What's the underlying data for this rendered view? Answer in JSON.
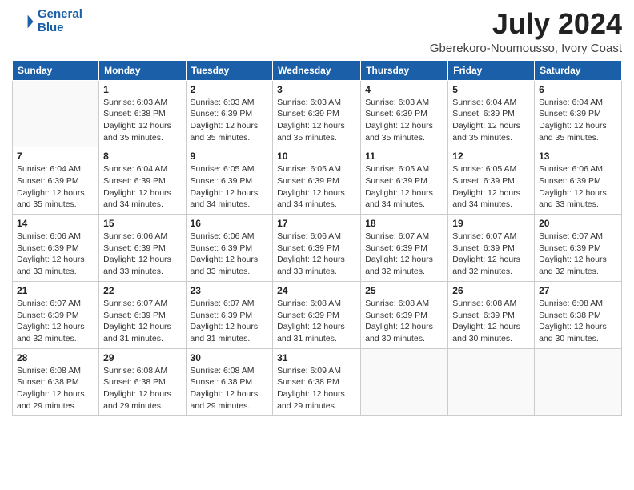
{
  "header": {
    "logo_line1": "General",
    "logo_line2": "Blue",
    "month_year": "July 2024",
    "location": "Gberekoro-Noumousso, Ivory Coast"
  },
  "days_of_week": [
    "Sunday",
    "Monday",
    "Tuesday",
    "Wednesday",
    "Thursday",
    "Friday",
    "Saturday"
  ],
  "weeks": [
    [
      {
        "day": "",
        "info": ""
      },
      {
        "day": "1",
        "info": "Sunrise: 6:03 AM\nSunset: 6:38 PM\nDaylight: 12 hours\nand 35 minutes."
      },
      {
        "day": "2",
        "info": "Sunrise: 6:03 AM\nSunset: 6:39 PM\nDaylight: 12 hours\nand 35 minutes."
      },
      {
        "day": "3",
        "info": "Sunrise: 6:03 AM\nSunset: 6:39 PM\nDaylight: 12 hours\nand 35 minutes."
      },
      {
        "day": "4",
        "info": "Sunrise: 6:03 AM\nSunset: 6:39 PM\nDaylight: 12 hours\nand 35 minutes."
      },
      {
        "day": "5",
        "info": "Sunrise: 6:04 AM\nSunset: 6:39 PM\nDaylight: 12 hours\nand 35 minutes."
      },
      {
        "day": "6",
        "info": "Sunrise: 6:04 AM\nSunset: 6:39 PM\nDaylight: 12 hours\nand 35 minutes."
      }
    ],
    [
      {
        "day": "7",
        "info": ""
      },
      {
        "day": "8",
        "info": "Sunrise: 6:04 AM\nSunset: 6:39 PM\nDaylight: 12 hours\nand 34 minutes."
      },
      {
        "day": "9",
        "info": "Sunrise: 6:05 AM\nSunset: 6:39 PM\nDaylight: 12 hours\nand 34 minutes."
      },
      {
        "day": "10",
        "info": "Sunrise: 6:05 AM\nSunset: 6:39 PM\nDaylight: 12 hours\nand 34 minutes."
      },
      {
        "day": "11",
        "info": "Sunrise: 6:05 AM\nSunset: 6:39 PM\nDaylight: 12 hours\nand 34 minutes."
      },
      {
        "day": "12",
        "info": "Sunrise: 6:05 AM\nSunset: 6:39 PM\nDaylight: 12 hours\nand 34 minutes."
      },
      {
        "day": "13",
        "info": "Sunrise: 6:06 AM\nSunset: 6:39 PM\nDaylight: 12 hours\nand 33 minutes."
      }
    ],
    [
      {
        "day": "14",
        "info": ""
      },
      {
        "day": "15",
        "info": "Sunrise: 6:06 AM\nSunset: 6:39 PM\nDaylight: 12 hours\nand 33 minutes."
      },
      {
        "day": "16",
        "info": "Sunrise: 6:06 AM\nSunset: 6:39 PM\nDaylight: 12 hours\nand 33 minutes."
      },
      {
        "day": "17",
        "info": "Sunrise: 6:06 AM\nSunset: 6:39 PM\nDaylight: 12 hours\nand 33 minutes."
      },
      {
        "day": "18",
        "info": "Sunrise: 6:07 AM\nSunset: 6:39 PM\nDaylight: 12 hours\nand 32 minutes."
      },
      {
        "day": "19",
        "info": "Sunrise: 6:07 AM\nSunset: 6:39 PM\nDaylight: 12 hours\nand 32 minutes."
      },
      {
        "day": "20",
        "info": "Sunrise: 6:07 AM\nSunset: 6:39 PM\nDaylight: 12 hours\nand 32 minutes."
      }
    ],
    [
      {
        "day": "21",
        "info": ""
      },
      {
        "day": "22",
        "info": "Sunrise: 6:07 AM\nSunset: 6:39 PM\nDaylight: 12 hours\nand 31 minutes."
      },
      {
        "day": "23",
        "info": "Sunrise: 6:07 AM\nSunset: 6:39 PM\nDaylight: 12 hours\nand 31 minutes."
      },
      {
        "day": "24",
        "info": "Sunrise: 6:08 AM\nSunset: 6:39 PM\nDaylight: 12 hours\nand 31 minutes."
      },
      {
        "day": "25",
        "info": "Sunrise: 6:08 AM\nSunset: 6:39 PM\nDaylight: 12 hours\nand 30 minutes."
      },
      {
        "day": "26",
        "info": "Sunrise: 6:08 AM\nSunset: 6:39 PM\nDaylight: 12 hours\nand 30 minutes."
      },
      {
        "day": "27",
        "info": "Sunrise: 6:08 AM\nSunset: 6:38 PM\nDaylight: 12 hours\nand 30 minutes."
      }
    ],
    [
      {
        "day": "28",
        "info": "Sunrise: 6:08 AM\nSunset: 6:38 PM\nDaylight: 12 hours\nand 29 minutes."
      },
      {
        "day": "29",
        "info": "Sunrise: 6:08 AM\nSunset: 6:38 PM\nDaylight: 12 hours\nand 29 minutes."
      },
      {
        "day": "30",
        "info": "Sunrise: 6:08 AM\nSunset: 6:38 PM\nDaylight: 12 hours\nand 29 minutes."
      },
      {
        "day": "31",
        "info": "Sunrise: 6:09 AM\nSunset: 6:38 PM\nDaylight: 12 hours\nand 29 minutes."
      },
      {
        "day": "",
        "info": ""
      },
      {
        "day": "",
        "info": ""
      },
      {
        "day": "",
        "info": ""
      }
    ]
  ],
  "week0_day7_info": "Sunrise: 6:04 AM\nSunset: 6:39 PM\nDaylight: 12 hours\nand 35 minutes.",
  "week1_day0_info": "Sunrise: 6:04 AM\nSunset: 6:39 PM\nDaylight: 12 hours\nand 35 minutes.",
  "week2_day0_info": "Sunrise: 6:06 AM\nSunset: 6:39 PM\nDaylight: 12 hours\nand 33 minutes.",
  "week3_day0_info": "Sunrise: 6:07 AM\nSunset: 6:39 PM\nDaylight: 12 hours\nand 32 minutes."
}
